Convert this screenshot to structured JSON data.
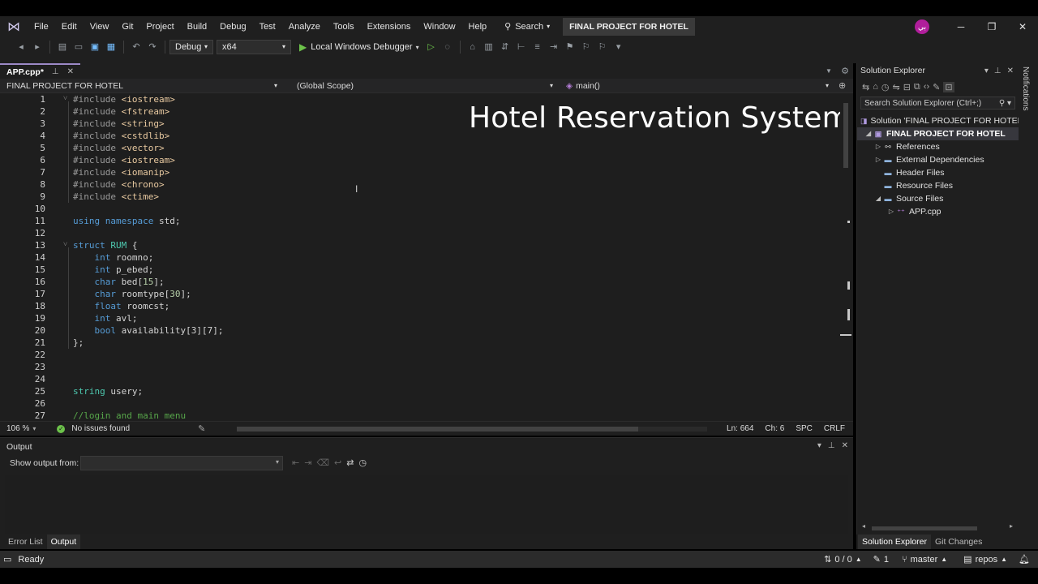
{
  "menubar": {
    "items": [
      "File",
      "Edit",
      "View",
      "Git",
      "Project",
      "Build",
      "Debug",
      "Test",
      "Analyze",
      "Tools",
      "Extensions",
      "Window",
      "Help"
    ],
    "search_label": "Search",
    "project_title": "FINAL PROJECT FOR HOTEL",
    "avatar_initials": "بي"
  },
  "toolbar": {
    "config": "Debug",
    "platform": "x64",
    "debugger": "Local Windows Debugger"
  },
  "editor": {
    "tab_label": "APP.cpp*",
    "nav_project": "FINAL PROJECT FOR HOTEL",
    "nav_scope": "(Global Scope)",
    "nav_member": "main()",
    "overlay_title": "Hotel Reservation System",
    "line_numbers": [
      "1",
      "2",
      "3",
      "4",
      "5",
      "6",
      "7",
      "8",
      "9",
      "10",
      "11",
      "12",
      "13",
      "14",
      "15",
      "16",
      "17",
      "18",
      "19",
      "20",
      "21",
      "22",
      "23",
      "24",
      "25",
      "26",
      "27"
    ],
    "lines": [
      {
        "t": "pre",
        "a": "#include ",
        "b": "<iostream>"
      },
      {
        "t": "pre",
        "a": "#include ",
        "b": "<fstream>"
      },
      {
        "t": "pre",
        "a": "#include ",
        "b": "<string>"
      },
      {
        "t": "pre",
        "a": "#include ",
        "b": "<cstdlib>"
      },
      {
        "t": "pre",
        "a": "#include ",
        "b": "<vector>"
      },
      {
        "t": "pre",
        "a": "#include ",
        "b": "<iostream>"
      },
      {
        "t": "pre",
        "a": "#include ",
        "b": "<iomanip>"
      },
      {
        "t": "pre",
        "a": "#include ",
        "b": "<chrono>"
      },
      {
        "t": "pre",
        "a": "#include ",
        "b": "<ctime>"
      },
      {
        "t": "empty"
      },
      {
        "t": "using",
        "a": "using ",
        "b": "namespace ",
        "c": "std;"
      },
      {
        "t": "empty"
      },
      {
        "t": "struct",
        "a": "struct ",
        "b": "RUM",
        "c": " {"
      },
      {
        "t": "decl",
        "a": "int ",
        "b": "roomno;"
      },
      {
        "t": "decl",
        "a": "int ",
        "b": "p_ebed;"
      },
      {
        "t": "decl",
        "a": "char ",
        "b": "bed[",
        "n": "15",
        "c": "];"
      },
      {
        "t": "decl",
        "a": "char ",
        "b": "roomtype[",
        "n": "30",
        "c": "];"
      },
      {
        "t": "decl",
        "a": "float ",
        "b": "roomcst;"
      },
      {
        "t": "decl",
        "a": "int ",
        "b": "avl;"
      },
      {
        "t": "decl",
        "a": "bool ",
        "b": "availability[3][7];"
      },
      {
        "t": "close",
        "a": "};"
      },
      {
        "t": "empty"
      },
      {
        "t": "empty"
      },
      {
        "t": "empty"
      },
      {
        "t": "string",
        "a": "string ",
        "b": "usery;"
      },
      {
        "t": "empty"
      },
      {
        "t": "comment",
        "a": "//login and main menu"
      }
    ]
  },
  "statusstrip": {
    "zoom": "106 %",
    "issues": "No issues found",
    "line": "Ln: 664",
    "col": "Ch: 6",
    "spc": "SPC",
    "eol": "CRLF"
  },
  "output": {
    "title": "Output",
    "show_from": "Show output from:"
  },
  "bottom_tabs": [
    "Error List",
    "Output"
  ],
  "solution_explorer": {
    "title": "Solution Explorer",
    "search_placeholder": "Search Solution Explorer (Ctrl+;)",
    "solution_label": "Solution 'FINAL PROJECT FOR HOTEL' (",
    "project_label": "FINAL PROJECT FOR HOTEL",
    "items": [
      "References",
      "External Dependencies",
      "Header Files",
      "Resource Files",
      "Source Files"
    ],
    "file": "APP.cpp",
    "tabs": [
      "Solution Explorer",
      "Git Changes"
    ]
  },
  "notifications_label": "Notifications",
  "statusbar": {
    "ready": "Ready",
    "changes": "0 / 0",
    "pending": "1",
    "branch": "master",
    "repo": "repos"
  },
  "colors": {
    "accent": "#9c89c7",
    "keyword": "#569cd6",
    "type": "#4ec9b0",
    "include": "#e8c9a0",
    "comment": "#57a64a"
  }
}
